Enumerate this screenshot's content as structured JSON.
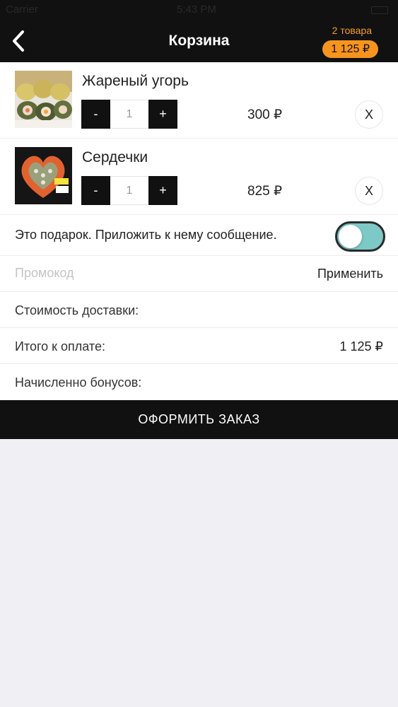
{
  "status_bar": {
    "carrier": "Carrier",
    "time": "5:43 PM"
  },
  "header": {
    "title": "Корзина",
    "cart_count": "2 товара",
    "cart_total": "1 125 ₽"
  },
  "items": [
    {
      "name": "Жареный угорь",
      "quantity": "1",
      "price": "300 ₽",
      "decrement_label": "-",
      "increment_label": "+",
      "remove_label": "X"
    },
    {
      "name": "Сердечки",
      "quantity": "1",
      "price": "825 ₽",
      "decrement_label": "-",
      "increment_label": "+",
      "remove_label": "X"
    }
  ],
  "gift": {
    "label": "Это подарок. Приложить к нему сообщение.",
    "enabled": true,
    "toggle_color": "#7cc9c8"
  },
  "promo": {
    "value": "",
    "placeholder": "Промокод",
    "apply_label": "Применить"
  },
  "summary": {
    "delivery_label": "Стоимость доставки:",
    "total_label": "Итого к оплате:",
    "total_value": "1 125  ₽",
    "bonus_label": "Начисленно бонусов:"
  },
  "checkout_label": "ОФОРМИТЬ ЗАКАЗ",
  "colors": {
    "accent": "#f7941e",
    "bar": "#111111",
    "background": "#efeff4"
  }
}
